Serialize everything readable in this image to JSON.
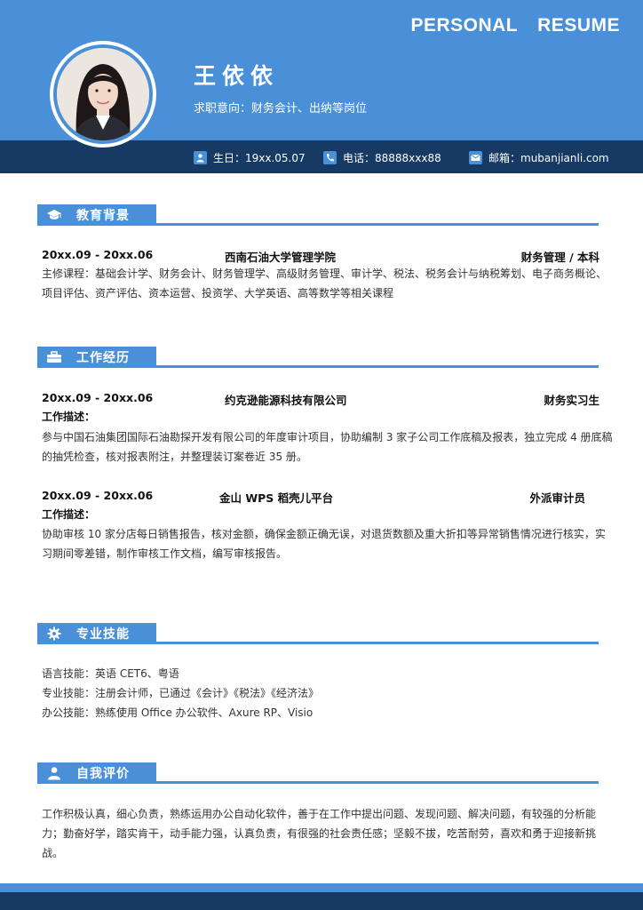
{
  "header": {
    "title_word1": "PERSONAL",
    "title_word2": "RESUME",
    "name": "王依依",
    "objective": "求职意向：财务会计、出纳等岗位"
  },
  "contact": {
    "birthday": "生日：19xx.05.07",
    "phone": "电话：88888xxx88",
    "email": "邮箱：mubanjianli.com"
  },
  "education": {
    "title": "教育背景",
    "date": "20xx.09 - 20xx.06",
    "school": "西南石油大学管理学院",
    "major": "财务管理 / 本科",
    "courses": "主修课程：基础会计学、财务会计、财务管理学、高级财务管理、审计学、税法、税务会计与纳税筹划、电子商务概论、项目评估、资产评估、资本运营、投资学、大学英语、高等数学等相关课程"
  },
  "work": {
    "title": "工作经历",
    "jobs": [
      {
        "date": "20xx.09 - 20xx.06",
        "company": "约克逊能源科技有限公司",
        "position": "财务实习生",
        "desc_label": "工作描述：",
        "desc": "参与中国石油集团国际石油勘探开发有限公司的年度审计项目，协助编制 3 家子公司工作底稿及报表，独立完成 4 册底稿的抽凭检查，核对报表附注，并整理装订案卷近 35 册。"
      },
      {
        "date": "20xx.09 - 20xx.06",
        "company": "金山 WPS 稻壳儿平台",
        "position": "外派审计员",
        "desc_label": "工作描述：",
        "desc": "协助审核 10 家分店每日销售报告，核对金额，确保金额正确无误，对退货数额及重大折扣等异常销售情况进行核实，实习期间零差错，制作审核工作文档，编写审核报告。"
      }
    ]
  },
  "skills": {
    "title": "专业技能",
    "items": [
      "语言技能：英语 CET6、粤语",
      "专业技能：注册会计师，已通过《会计》《税法》《经济法》",
      "办公技能：熟练使用 Office 办公软件、Axure RP、Visio"
    ]
  },
  "self_eval": {
    "title": "自我评价",
    "text": "工作积极认真，细心负责，熟练运用办公自动化软件，善于在工作中提出问题、发现问题、解决问题，有较强的分析能力；勤奋好学，踏实肯干，动手能力强，认真负责，有很强的社会责任感；坚毅不拔，吃苦耐劳，喜欢和勇于迎接新挑战。"
  },
  "icons": {
    "contact": [
      "person-icon",
      "phone-icon",
      "email-icon"
    ],
    "sections": [
      "graduation-cap-icon",
      "briefcase-icon",
      "gear-icon",
      "user-icon"
    ]
  },
  "colors": {
    "accent": "#4a90d9",
    "dark": "#173a64"
  }
}
